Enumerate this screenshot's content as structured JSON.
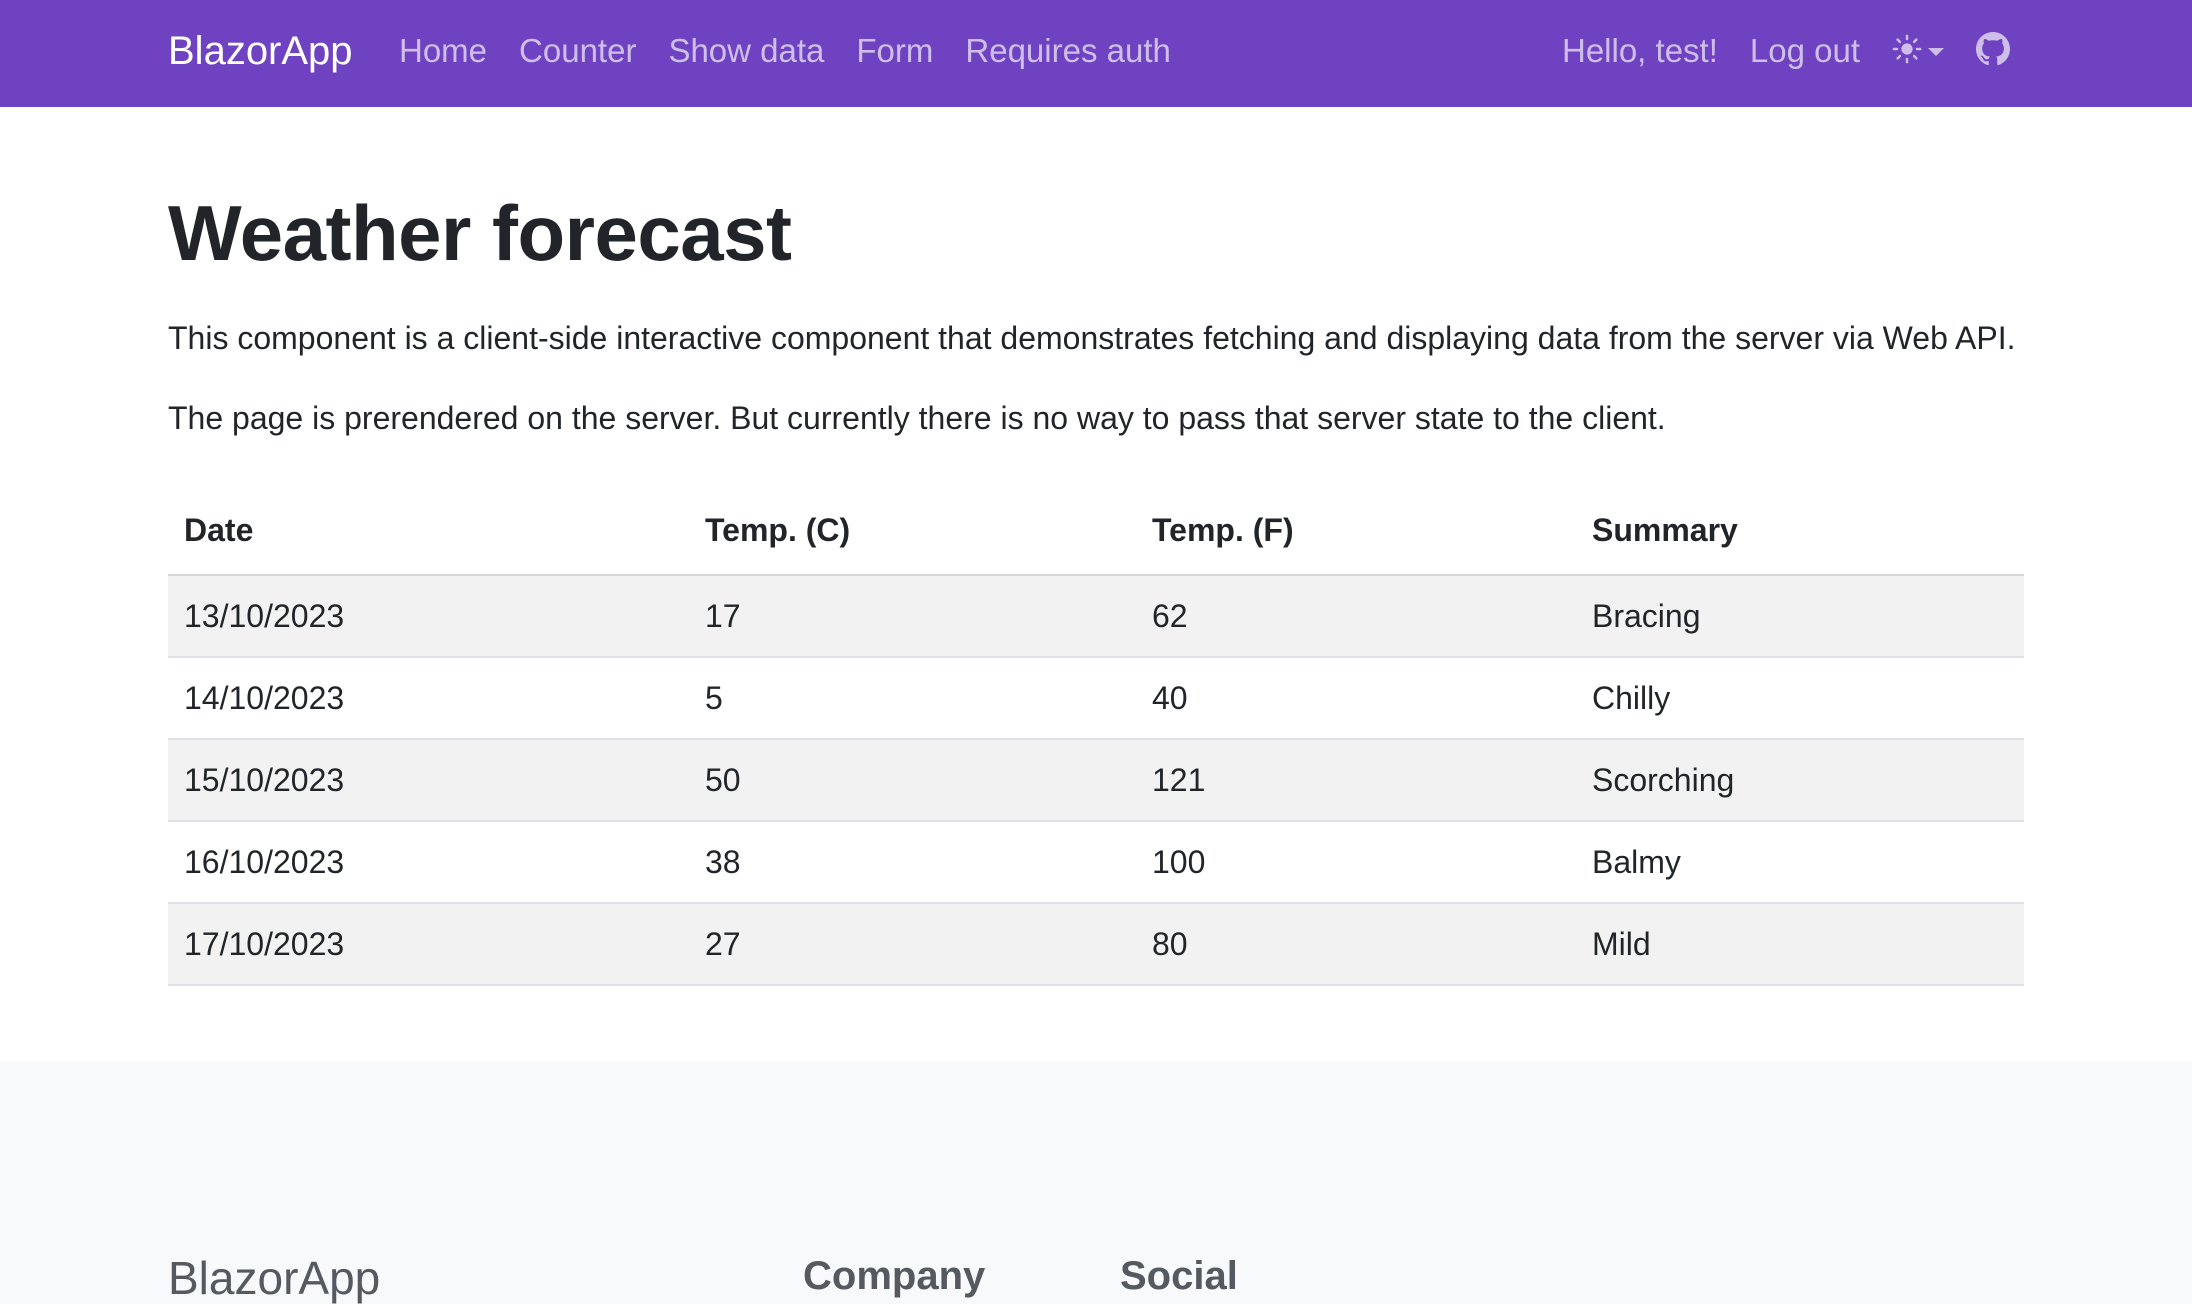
{
  "navbar": {
    "brand": "BlazorApp",
    "links": [
      {
        "label": "Home"
      },
      {
        "label": "Counter"
      },
      {
        "label": "Show data"
      },
      {
        "label": "Form"
      },
      {
        "label": "Requires auth"
      }
    ],
    "greeting": "Hello, test!",
    "logout_label": "Log out",
    "theme_icon": "sun-icon",
    "github_icon": "github-icon",
    "color": "#6f42c1"
  },
  "main": {
    "title": "Weather forecast",
    "paragraph1": "This component is a client-side interactive component that demonstrates fetching and displaying data from the server via Web API.",
    "paragraph2": "The page is prerendered on the server. But currently there is no way to pass that server state to the client.",
    "table": {
      "headers": [
        "Date",
        "Temp. (C)",
        "Temp. (F)",
        "Summary"
      ],
      "rows": [
        [
          "13/10/2023",
          "17",
          "62",
          "Bracing"
        ],
        [
          "14/10/2023",
          "5",
          "40",
          "Chilly"
        ],
        [
          "15/10/2023",
          "50",
          "121",
          "Scorching"
        ],
        [
          "16/10/2023",
          "38",
          "100",
          "Balmy"
        ],
        [
          "17/10/2023",
          "27",
          "80",
          "Mild"
        ]
      ]
    }
  },
  "footer": {
    "brand": "BlazorApp",
    "headings": [
      "Company",
      "Social"
    ]
  }
}
